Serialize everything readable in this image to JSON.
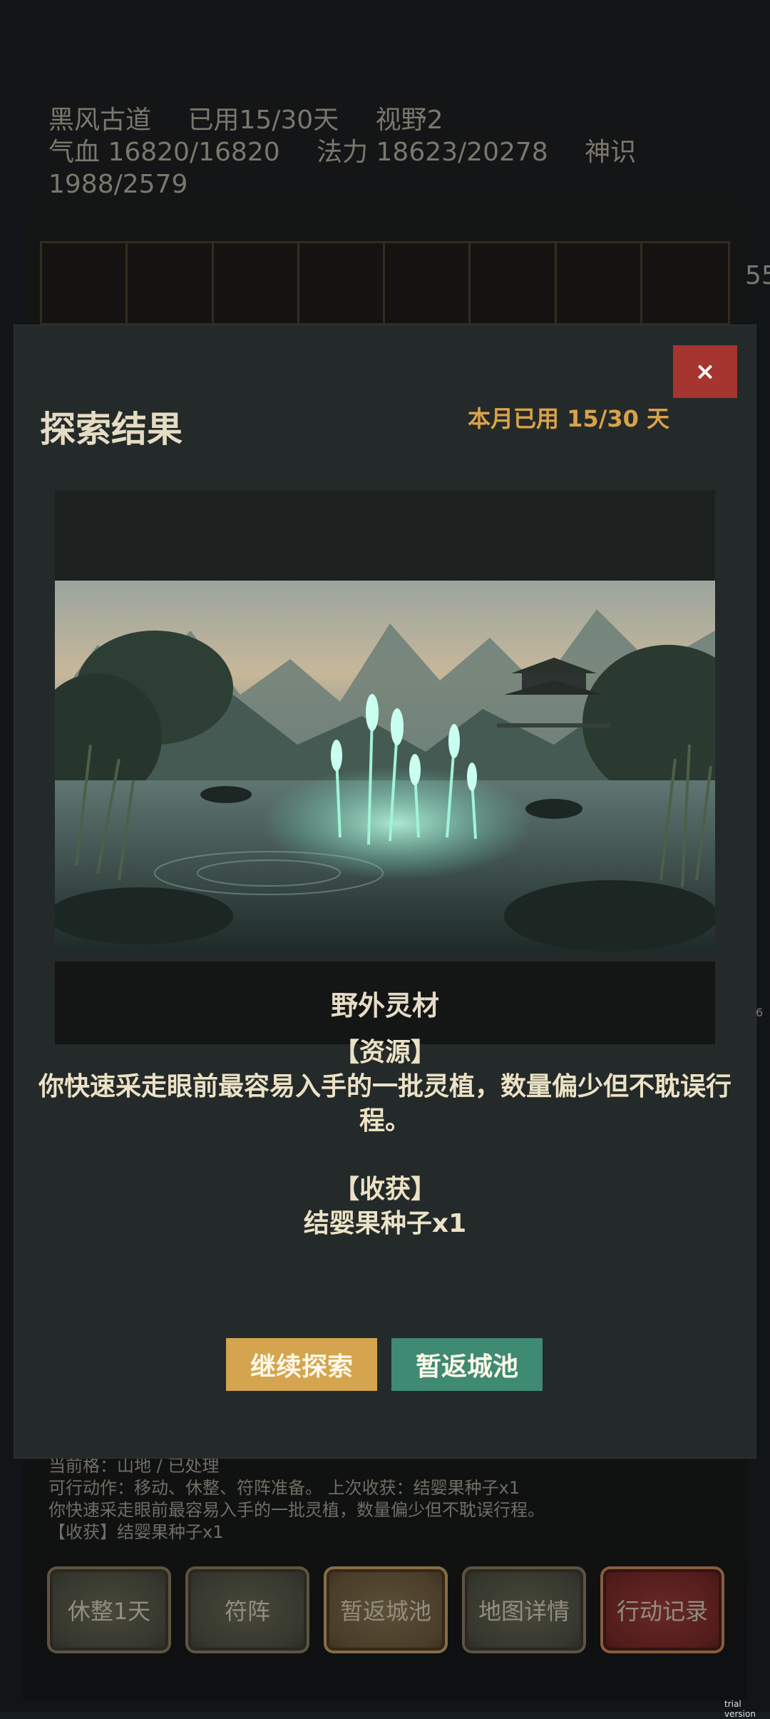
{
  "status": {
    "location": "黑风古道",
    "days_used": "已用15/30天",
    "vision": "视野2",
    "hp": "气血 16820/16820",
    "mana": "法力 18623/20278",
    "spirit_label": "神识",
    "spirit_value": "1988/2579"
  },
  "edge": {
    "right_number": "55",
    "right_small": "6"
  },
  "log": {
    "line1": "当前格：山地 / 已处理",
    "line2": "可行动作：移动、休整、符阵准备。   上次收获：结婴果种子x1",
    "line3": "你快速采走眼前最容易入手的一批灵植，数量偏少但不耽误行程。",
    "line4": "【收获】结婴果种子x1"
  },
  "bottom_bar": {
    "rest": "休整1天",
    "formation": "符阵",
    "return_city": "暂返城池",
    "map_details": "地图详情",
    "action_log": "行动记录"
  },
  "modal": {
    "close": "×",
    "title": "探索结果",
    "month_used": "本月已用 15/30 天",
    "image_caption": "野外灵材",
    "resource_header": "【资源】",
    "resource_text": "你快速采走眼前最容易入手的一批灵植，数量偏少但不耽误行程。",
    "harvest_header": "【收获】",
    "harvest_item": "结婴果种子x1",
    "continue_button": "继续探索",
    "return_button": "暂返城池"
  },
  "watermark": "trial version",
  "colors": {
    "accent_gold": "#d9a24a",
    "continue_button": "#d4a44e",
    "return_button": "#3e8a73",
    "close_button": "#a5352e"
  }
}
